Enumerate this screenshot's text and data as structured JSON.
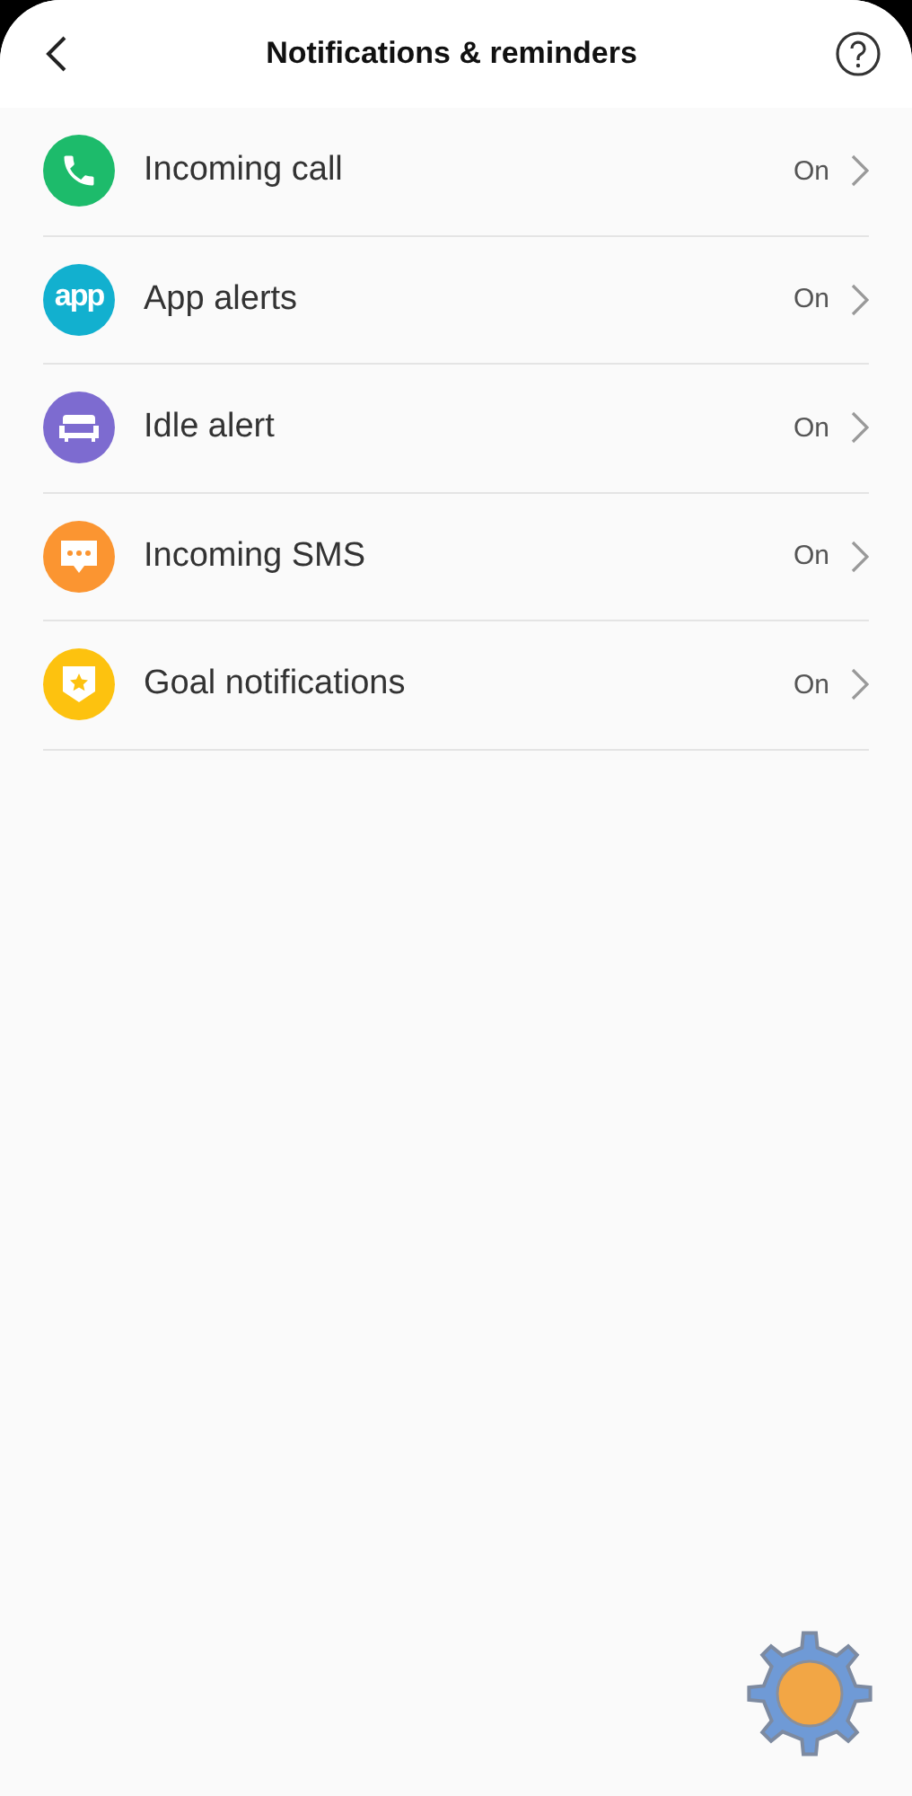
{
  "header": {
    "title": "Notifications & reminders"
  },
  "items": [
    {
      "kind": "phone",
      "color": "#1dbb6b",
      "label": "Incoming call",
      "status": "On"
    },
    {
      "kind": "app",
      "color": "#12b0cf",
      "icon_text": "app",
      "label": "App alerts",
      "status": "On"
    },
    {
      "kind": "sofa",
      "color": "#7d6bd0",
      "label": "Idle alert",
      "status": "On"
    },
    {
      "kind": "chat",
      "color": "#fb9531",
      "label": "Incoming SMS",
      "status": "On"
    },
    {
      "kind": "badge",
      "color": "#fdc20f",
      "label": "Goal notifications",
      "status": "On"
    }
  ]
}
